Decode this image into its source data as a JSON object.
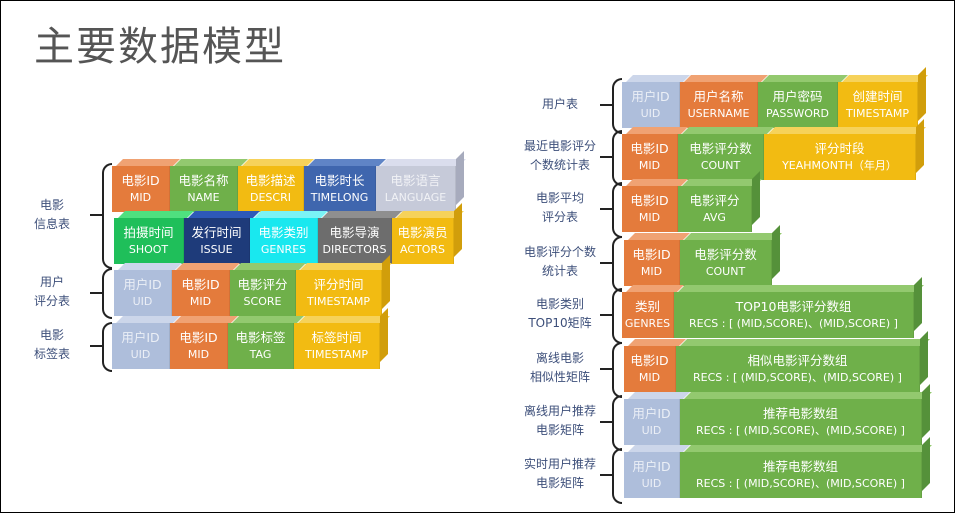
{
  "title": "主要数据模型",
  "colors": {
    "orange": "#e47b3c",
    "green": "#6fb04a",
    "yellow": "#f2bb12",
    "blue": "#3f66ae",
    "lavender": "#c6cad9",
    "light_blue": "#aebedb",
    "kelly_green": "#1fbf5a",
    "navy": "#1e3b7a",
    "cyan": "#19e8ef",
    "grey": "#6d6d6d",
    "label_text": "#3d4f7a"
  },
  "left_tables": [
    {
      "label": [
        "电影",
        "信息表"
      ],
      "rows": [
        [
          {
            "cn": "电影ID",
            "en": "MID",
            "color": "orange"
          },
          {
            "cn": "电影名称",
            "en": "NAME",
            "color": "green"
          },
          {
            "cn": "电影描述",
            "en": "DESCRI",
            "color": "yellow"
          },
          {
            "cn": "电影时长",
            "en": "TIMELONG",
            "color": "blue"
          },
          {
            "cn": "电影语言",
            "en": "LANGUAGE",
            "color": "lavender"
          }
        ],
        [
          {
            "cn": "拍摄时间",
            "en": "SHOOT",
            "color": "kelly_green"
          },
          {
            "cn": "发行时间",
            "en": "ISSUE",
            "color": "navy"
          },
          {
            "cn": "电影类别",
            "en": "GENRES",
            "color": "cyan"
          },
          {
            "cn": "电影导演",
            "en": "DIRECTORS",
            "color": "grey"
          },
          {
            "cn": "电影演员",
            "en": "ACTORS",
            "color": "yellow"
          }
        ]
      ]
    },
    {
      "label": [
        "用户",
        "评分表"
      ],
      "rows": [
        [
          {
            "cn": "用户ID",
            "en": "UID",
            "color": "light_blue"
          },
          {
            "cn": "电影ID",
            "en": "MID",
            "color": "orange"
          },
          {
            "cn": "电影评分",
            "en": "SCORE",
            "color": "green"
          },
          {
            "cn": "评分时间",
            "en": "TIMESTAMP",
            "color": "yellow"
          }
        ]
      ]
    },
    {
      "label": [
        "电影",
        "标签表"
      ],
      "rows": [
        [
          {
            "cn": "用户ID",
            "en": "UID",
            "color": "light_blue"
          },
          {
            "cn": "电影ID",
            "en": "MID",
            "color": "orange"
          },
          {
            "cn": "电影标签",
            "en": "TAG",
            "color": "green"
          },
          {
            "cn": "标签时间",
            "en": "TIMESTAMP",
            "color": "yellow"
          }
        ]
      ]
    }
  ],
  "right_tables": [
    {
      "label": [
        "用户表"
      ],
      "cells": [
        {
          "cn": "用户ID",
          "en": "UID",
          "color": "light_blue"
        },
        {
          "cn": "用户名称",
          "en": "USERNAME",
          "color": "orange"
        },
        {
          "cn": "用户密码",
          "en": "PASSWORD",
          "color": "green"
        },
        {
          "cn": "创建时间",
          "en": "TIMESTAMP",
          "color": "yellow"
        }
      ]
    },
    {
      "label": [
        "最近电影评分",
        "个数统计表"
      ],
      "cells": [
        {
          "cn": "电影ID",
          "en": "MID",
          "color": "orange"
        },
        {
          "cn": "电影评分数",
          "en": "COUNT",
          "color": "green"
        },
        {
          "cn": "评分时段",
          "en": "YEAHMONTH（年月）",
          "color": "yellow"
        }
      ]
    },
    {
      "label": [
        "电影平均",
        "评分表"
      ],
      "cells": [
        {
          "cn": "电影ID",
          "en": "MID",
          "color": "orange"
        },
        {
          "cn": "电影评分",
          "en": "AVG",
          "color": "green"
        }
      ]
    },
    {
      "label": [
        "电影评分个数",
        "统计表"
      ],
      "cells": [
        {
          "cn": "电影ID",
          "en": "MID",
          "color": "orange"
        },
        {
          "cn": "电影评分数",
          "en": "COUNT",
          "color": "green"
        }
      ]
    },
    {
      "label": [
        "电影类别",
        "TOP10矩阵"
      ],
      "cells": [
        {
          "cn": "类别",
          "en": "GENRES",
          "color": "orange"
        },
        {
          "cn": "TOP10电影评分数组",
          "en": "RECS : [ (MID,SCORE)、(MID,SCORE) ]",
          "color": "green"
        }
      ]
    },
    {
      "label": [
        "离线电影",
        "相似性矩阵"
      ],
      "cells": [
        {
          "cn": "电影ID",
          "en": "MID",
          "color": "orange"
        },
        {
          "cn": "相似电影评分数组",
          "en": "RECS : [ (MID,SCORE)、(MID,SCORE) ]",
          "color": "green"
        }
      ]
    },
    {
      "label": [
        "离线用户推荐",
        "电影矩阵"
      ],
      "cells": [
        {
          "cn": "用户ID",
          "en": "UID",
          "color": "light_blue"
        },
        {
          "cn": "推荐电影数组",
          "en": "RECS : [ (MID,SCORE)、(MID,SCORE) ]",
          "color": "green"
        }
      ]
    },
    {
      "label": [
        "实时用户推荐",
        "电影矩阵"
      ],
      "cells": [
        {
          "cn": "用户ID",
          "en": "UID",
          "color": "light_blue"
        },
        {
          "cn": "推荐电影数组",
          "en": "RECS : [ (MID,SCORE)、(MID,SCORE) ]",
          "color": "green"
        }
      ]
    }
  ]
}
